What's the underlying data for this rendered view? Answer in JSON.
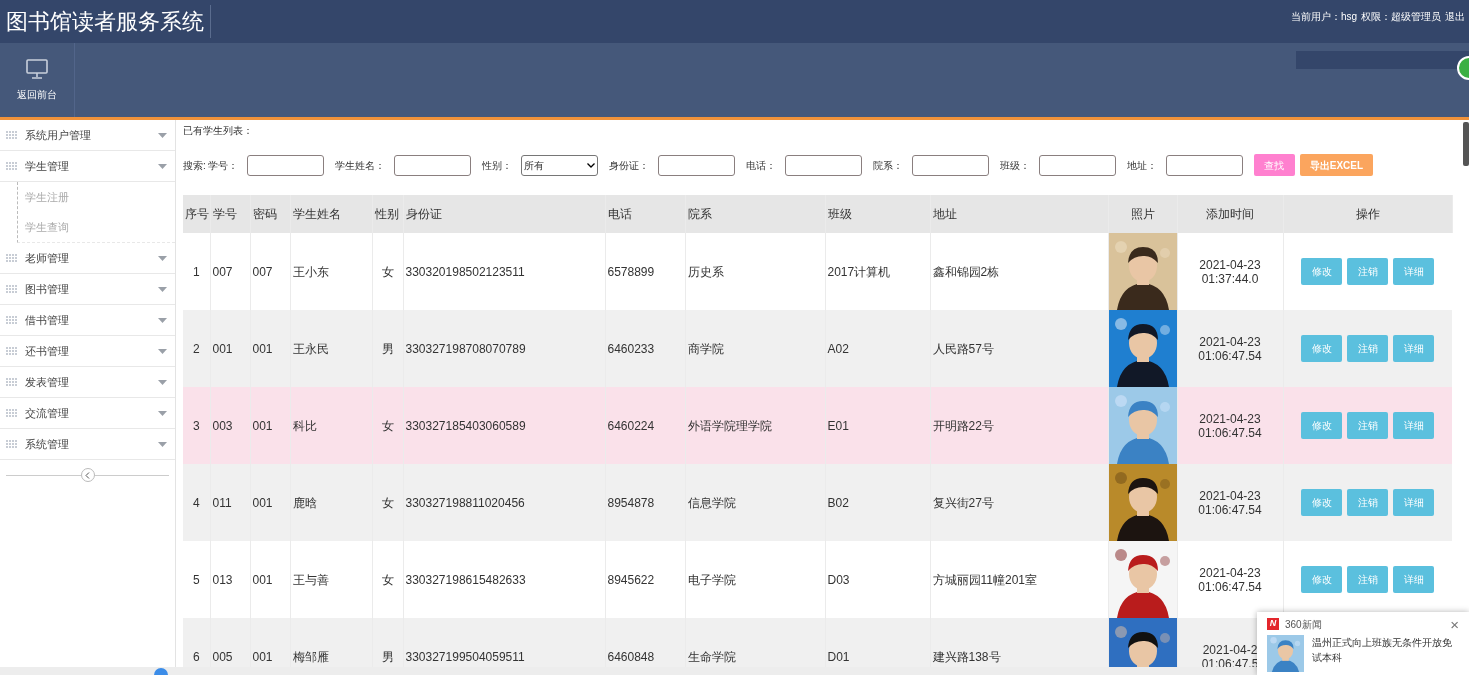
{
  "header": {
    "title": "图书馆读者服务系统",
    "user": "当前用户：hsg",
    "role": "权限：超级管理员",
    "logout": "退出"
  },
  "toolbar": {
    "buttons": [
      {
        "label": "返回前台"
      }
    ]
  },
  "sidebar": {
    "items": [
      {
        "label": "系统用户管理"
      },
      {
        "label": "学生管理",
        "children": [
          {
            "label": "学生注册"
          },
          {
            "label": "学生查询"
          }
        ]
      },
      {
        "label": "老师管理"
      },
      {
        "label": "图书管理"
      },
      {
        "label": "借书管理"
      },
      {
        "label": "还书管理"
      },
      {
        "label": "发表管理"
      },
      {
        "label": "交流管理"
      },
      {
        "label": "系统管理"
      }
    ]
  },
  "list_title": "已有学生列表：",
  "search": {
    "label": "搜索:",
    "fields": [
      {
        "label": "学号：",
        "kind": "input"
      },
      {
        "label": "学生姓名：",
        "kind": "input"
      },
      {
        "label": "性别：",
        "kind": "select",
        "value": "所有"
      },
      {
        "label": "身份证：",
        "kind": "input"
      },
      {
        "label": "电话：",
        "kind": "input"
      },
      {
        "label": "院系：",
        "kind": "input"
      },
      {
        "label": "班级：",
        "kind": "input"
      },
      {
        "label": "地址：",
        "kind": "input"
      }
    ],
    "buttons": [
      {
        "label": "查找",
        "kind": "search"
      },
      {
        "label": "导出EXCEL",
        "kind": "export"
      }
    ]
  },
  "table": {
    "columns": [
      "序号",
      "学号",
      "密码",
      "学生姓名",
      "性别",
      "身份证",
      "电话",
      "院系",
      "班级",
      "地址",
      "照片",
      "添加时间",
      "操作"
    ],
    "rows": [
      {
        "highlighted": false,
        "cells": [
          "1",
          "007",
          "007",
          "王小东",
          "女",
          "330320198502123511",
          "6578899",
          "历史系",
          "2017计算机",
          "鑫和锦园2栋"
        ],
        "photo": {
          "kind": "picture"
        },
        "added": [
          "2021-04-23",
          "01:37:44.0"
        ],
        "actions": [
          "修改",
          "注销",
          "详细"
        ]
      },
      {
        "highlighted": false,
        "cells": [
          "2",
          "001",
          "001",
          "王永民",
          "男",
          "330327198708070789",
          "6460233",
          "商学院",
          "A02",
          "人民路57号"
        ],
        "photo": {
          "kind": "picture"
        },
        "added": [
          "2021-04-23",
          "01:06:47.54"
        ],
        "actions": [
          "修改",
          "注销",
          "详细"
        ]
      },
      {
        "highlighted": true,
        "cells": [
          "3",
          "003",
          "001",
          "科比",
          "女",
          "330327185403060589",
          "6460224",
          "外语学院理学院",
          "E01",
          "开明路22号"
        ],
        "photo": {
          "kind": "picture"
        },
        "added": [
          "2021-04-23",
          "01:06:47.54"
        ],
        "actions": [
          "修改",
          "注销",
          "详细"
        ]
      },
      {
        "highlighted": false,
        "cells": [
          "4",
          "011",
          "001",
          "鹿晗",
          "女",
          "330327198811020456",
          "8954878",
          "信息学院",
          "B02",
          "复兴街27号"
        ],
        "photo": {
          "kind": "picture"
        },
        "added": [
          "2021-04-23",
          "01:06:47.54"
        ],
        "actions": [
          "修改",
          "注销",
          "详细"
        ]
      },
      {
        "highlighted": false,
        "cells": [
          "5",
          "013",
          "001",
          "王与善",
          "女",
          "330327198615482633",
          "8945622",
          "电子学院",
          "D03",
          "方城丽园11幢201室"
        ],
        "photo": {
          "kind": "picture"
        },
        "added": [
          "2021-04-23",
          "01:06:47.54"
        ],
        "actions": [
          "修改",
          "注销",
          "详细"
        ]
      },
      {
        "highlighted": false,
        "cells": [
          "6",
          "005",
          "001",
          "梅邹雁",
          "男",
          "330327199504059511",
          "6460848",
          "生命学院",
          "D01",
          "建兴路138号"
        ],
        "photo": {
          "kind": "picture"
        },
        "added": [
          "2021-04-2",
          "01:06:47.5"
        ]
      }
    ]
  },
  "notification": {
    "logo": "N",
    "source": "360新闻",
    "close": "×",
    "headline": "温州正式向上班族无条件开放免试本科",
    "image": {
      "kind": "picture"
    }
  }
}
